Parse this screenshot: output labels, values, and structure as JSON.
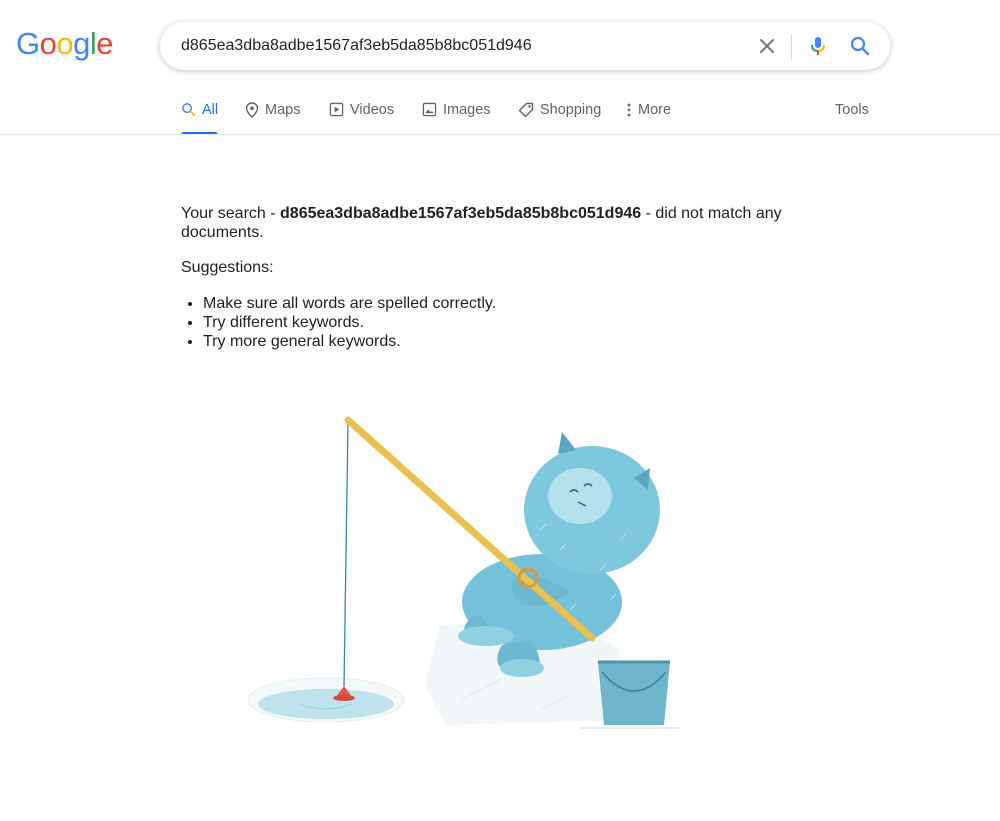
{
  "logo": {
    "letters": [
      "G",
      "o",
      "o",
      "g",
      "l",
      "e"
    ],
    "colors": [
      "#4285F4",
      "#EA4335",
      "#FBBC05",
      "#4285F4",
      "#34A853",
      "#EA4335"
    ]
  },
  "search": {
    "query": "d865ea3dba8adbe1567af3eb5da85b8bc051d946"
  },
  "tabs": [
    {
      "label": "All",
      "icon": "search-icon",
      "active": true
    },
    {
      "label": "Maps",
      "icon": "map-pin-icon",
      "active": false
    },
    {
      "label": "Videos",
      "icon": "video-play-icon",
      "active": false
    },
    {
      "label": "Images",
      "icon": "image-icon",
      "active": false
    },
    {
      "label": "Shopping",
      "icon": "tag-icon",
      "active": false
    },
    {
      "label": "More",
      "icon": "more-vert-icon",
      "active": false
    }
  ],
  "tools_label": "Tools",
  "no_results": {
    "prefix": "Your search - ",
    "query": "d865ea3dba8adbe1567af3eb5da85b8bc051d946",
    "suffix": " - did not match any documents."
  },
  "suggestions": {
    "title": "Suggestions:",
    "items": [
      "Make sure all words are spelled correctly.",
      "Try different keywords.",
      "Try more general keywords."
    ]
  },
  "colors": {
    "accent": "#1a73e8",
    "tab_text": "#5f6368",
    "text": "#202124",
    "mic_blue": "#4285F4",
    "mic_red": "#EA4335",
    "mic_yellow": "#FBBC05",
    "mic_green": "#34A853"
  }
}
